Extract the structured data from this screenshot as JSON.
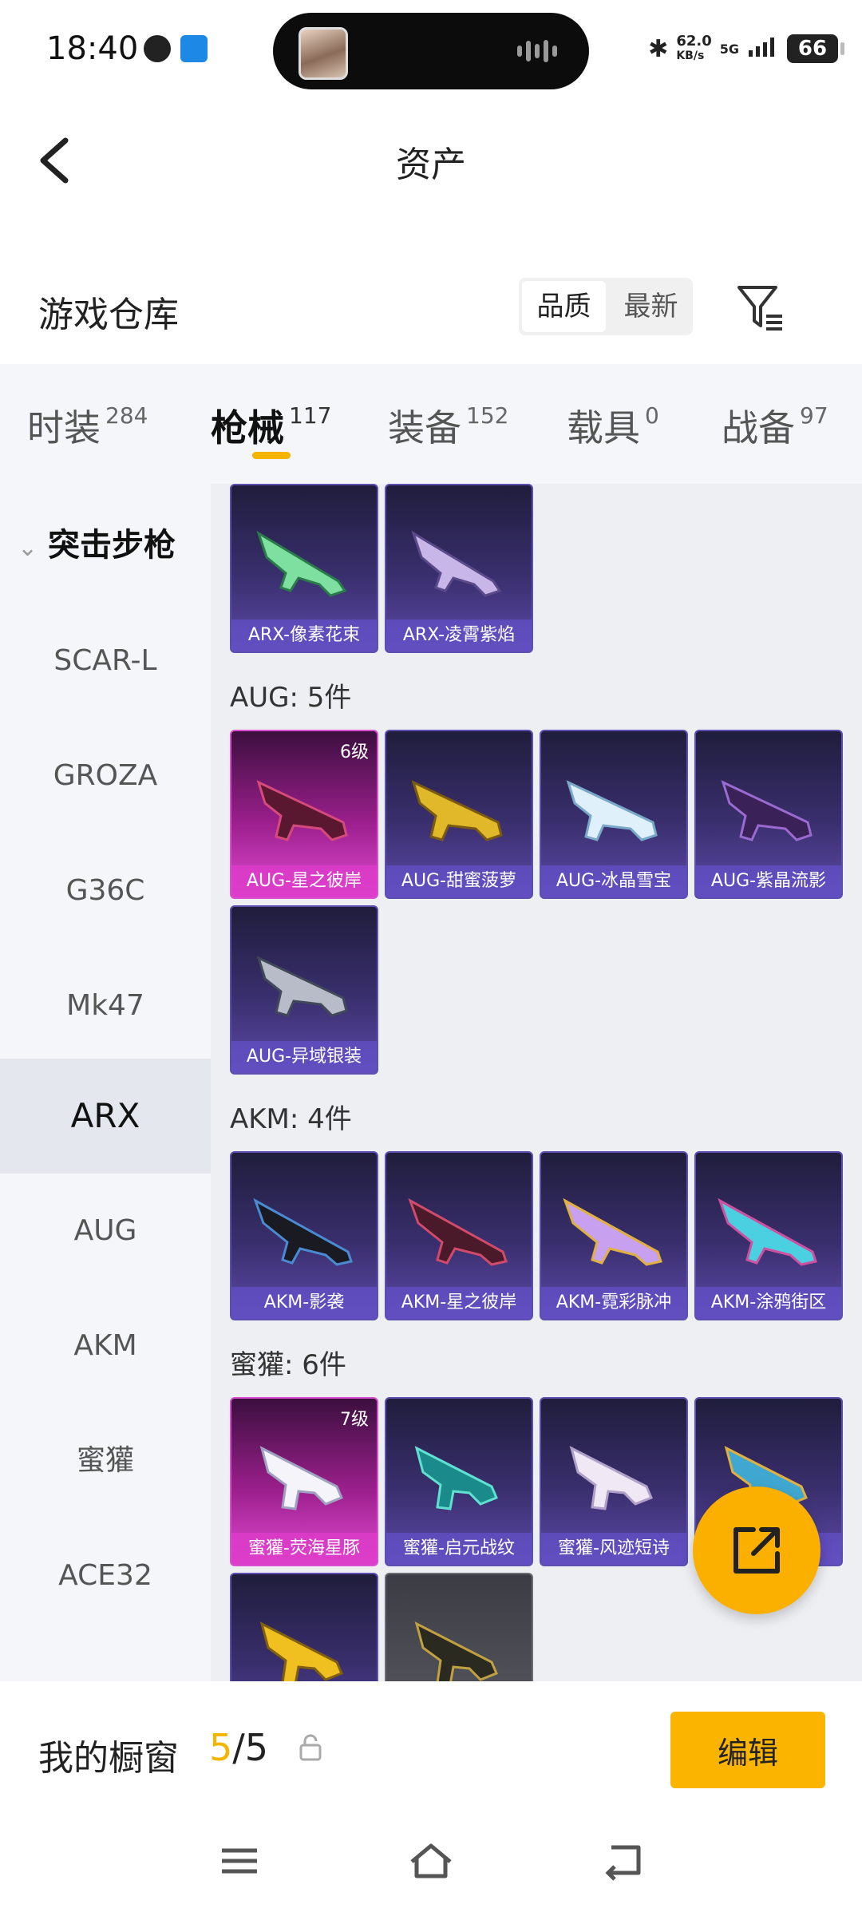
{
  "status_bar": {
    "time": "18:40",
    "speed_value": "62.0",
    "speed_unit": "KB/s",
    "network": "5G",
    "battery": "66"
  },
  "header": {
    "title": "资产"
  },
  "warehouse": {
    "title": "游戏仓库",
    "sort_quality": "品质",
    "sort_newest": "最新"
  },
  "tabs": [
    {
      "label": "时装",
      "count": "284"
    },
    {
      "label": "枪械",
      "count": "117"
    },
    {
      "label": "装备",
      "count": "152"
    },
    {
      "label": "载具",
      "count": "0"
    },
    {
      "label": "战备",
      "count": "97"
    }
  ],
  "sidebar": {
    "heading": "突击步枪",
    "items": [
      "SCAR-L",
      "GROZA",
      "G36C",
      "Mk47",
      "ARX",
      "AUG",
      "AKM",
      "蜜獾",
      "ACE32"
    ],
    "active": "ARX"
  },
  "groups": [
    {
      "label": "",
      "items": [
        {
          "name": "ARX-像素花束",
          "level": "",
          "rarity": "purple"
        },
        {
          "name": "ARX-凌霄紫焰",
          "level": "",
          "rarity": "purple"
        }
      ]
    },
    {
      "label": "AUG: 5件",
      "items": [
        {
          "name": "AUG-星之彼岸",
          "level": "6级",
          "rarity": "pink"
        },
        {
          "name": "AUG-甜蜜菠萝",
          "level": "",
          "rarity": "purple"
        },
        {
          "name": "AUG-冰晶雪宝",
          "level": "",
          "rarity": "purple"
        },
        {
          "name": "AUG-紫晶流影",
          "level": "",
          "rarity": "purple"
        },
        {
          "name": "AUG-异域银装",
          "level": "",
          "rarity": "purple"
        }
      ]
    },
    {
      "label": "AKM: 4件",
      "items": [
        {
          "name": "AKM-影袭",
          "level": "",
          "rarity": "purple"
        },
        {
          "name": "AKM-星之彼岸",
          "level": "",
          "rarity": "purple"
        },
        {
          "name": "AKM-霓彩脉冲",
          "level": "",
          "rarity": "purple"
        },
        {
          "name": "AKM-涂鸦街区",
          "level": "",
          "rarity": "purple"
        }
      ]
    },
    {
      "label": "蜜獾: 6件",
      "items": [
        {
          "name": "蜜獾-荧海星豚",
          "level": "7级",
          "rarity": "pink"
        },
        {
          "name": "蜜獾-启元战纹",
          "level": "",
          "rarity": "purple"
        },
        {
          "name": "蜜獾-风迹短诗",
          "level": "",
          "rarity": "purple"
        },
        {
          "name": "",
          "level": "",
          "rarity": "purple"
        },
        {
          "name": "",
          "level": "",
          "rarity": "purple"
        },
        {
          "name": "",
          "level": "",
          "rarity": "grey"
        }
      ]
    }
  ],
  "showcase": {
    "label": "我的橱窗",
    "current": "5",
    "separator": "/",
    "total": "5",
    "edit_label": "编辑"
  },
  "colors": {
    "accent": "#fbb400",
    "purple_card": "#3a2f6e",
    "pink_card": "#9b1f8c",
    "grey_card": "#5a5a62"
  },
  "icons": {
    "back": "back-arrow-icon",
    "filter": "filter-icon",
    "share": "share-icon",
    "lock": "lock-icon"
  }
}
